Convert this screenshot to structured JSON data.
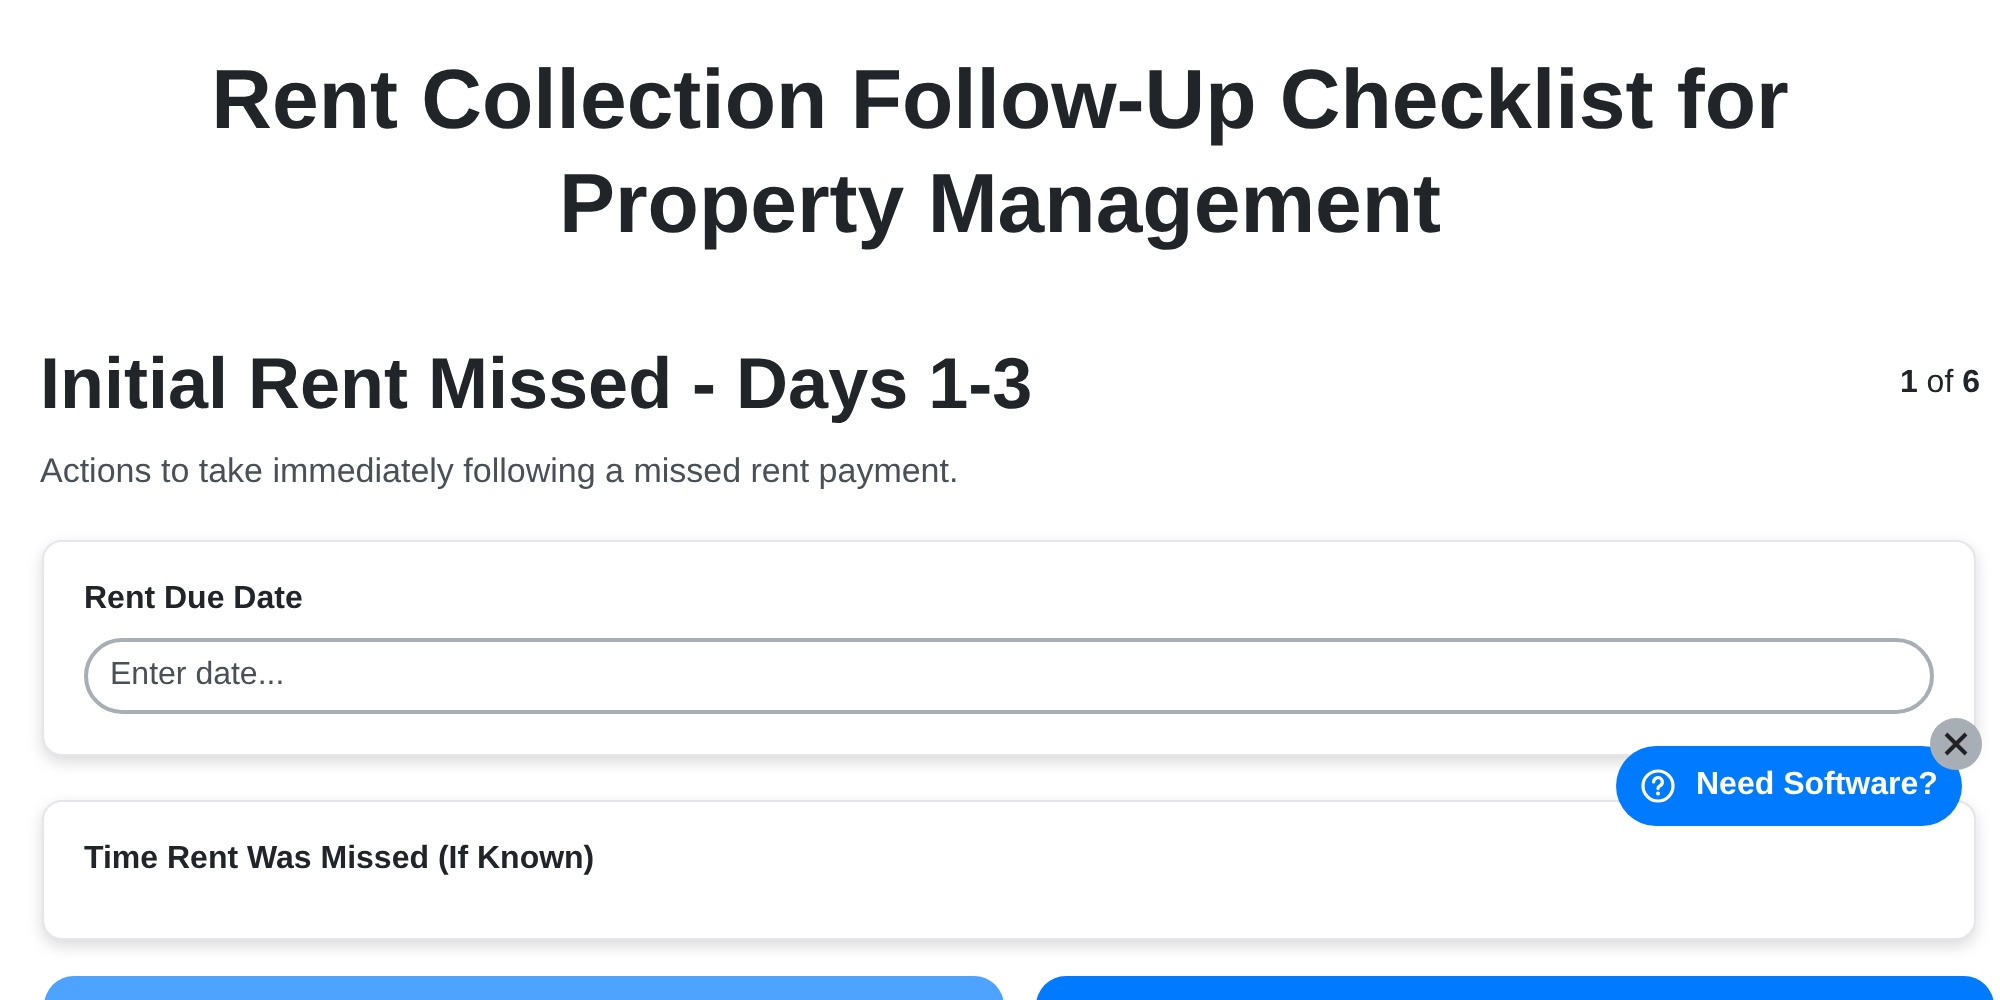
{
  "title": "Rent Collection Follow-Up Checklist for Property Management",
  "section": {
    "heading": "Initial Rent Missed - Days 1-3",
    "counter": "**1** of **6**",
    "description": "Actions to take immediately following a missed rent payment."
  },
  "fields": [
    {
      "label": "Rent Due Date",
      "placeholder": "Enter date..."
    },
    {
      "label": "Time Rent Was Missed (If Known)"
    }
  ],
  "help_widget": {
    "label": "Need Software?"
  }
}
